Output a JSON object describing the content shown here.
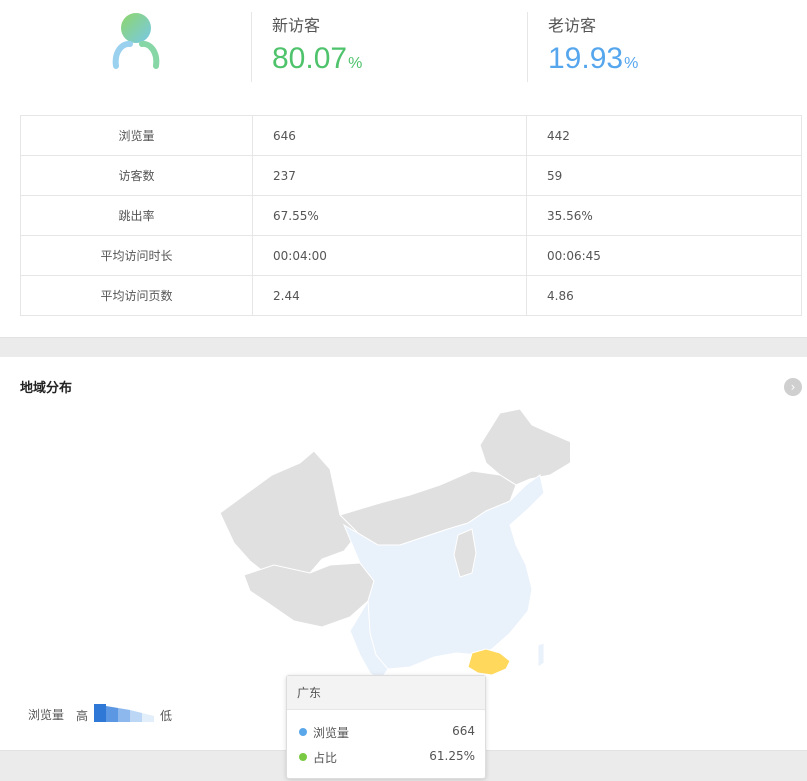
{
  "visitors": {
    "new": {
      "label": "新访客",
      "value": "80.07",
      "unit": "%",
      "color": "#4ec36b"
    },
    "old": {
      "label": "老访客",
      "value": "19.93",
      "unit": "%",
      "color": "#56a6ee"
    }
  },
  "table": {
    "rows": [
      {
        "name": "浏览量",
        "new": "646",
        "old": "442"
      },
      {
        "name": "访客数",
        "new": "237",
        "old": "59"
      },
      {
        "name": "跳出率",
        "new": "67.55%",
        "old": "35.56%"
      },
      {
        "name": "平均访问时长",
        "new": "00:04:00",
        "old": "00:06:45"
      },
      {
        "name": "平均访问页数",
        "new": "2.44",
        "old": "4.86"
      }
    ]
  },
  "geo": {
    "title": "地域分布",
    "more_icon": "chevron-right-icon",
    "legend": {
      "title": "浏览量",
      "high": "高",
      "low": "低"
    },
    "highlight_color": "#ffd85c",
    "active_color": "#e9f1fb",
    "inactive_color": "#e0e0e0",
    "tooltip": {
      "region": "广东",
      "rows": [
        {
          "name": "浏览量",
          "value": "664",
          "color": "#5aa8ea"
        },
        {
          "name": "占比",
          "value": "61.25%",
          "color": "#7ac943"
        }
      ]
    }
  }
}
